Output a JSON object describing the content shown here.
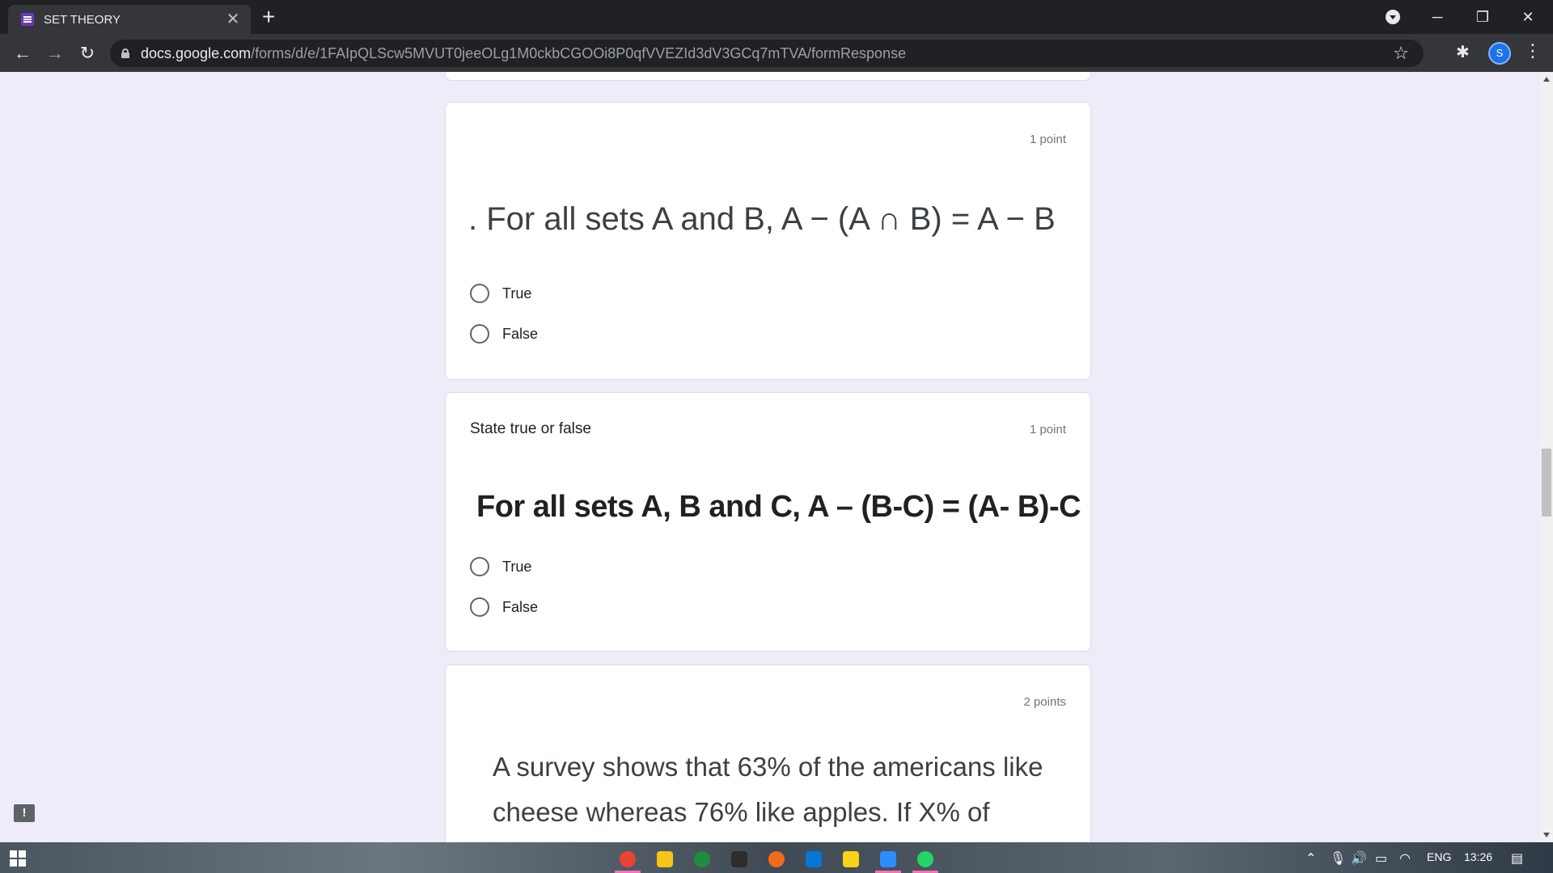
{
  "browser": {
    "tab_title": "SET THEORY",
    "tab_close": "✕",
    "new_tab": "+",
    "url_host": "docs.google.com",
    "url_path": "/forms/d/e/1FAIpQLScw5MVUT0jeeOLg1M0ckbCGOOi8P0qfVVEZId3dV3GCq7mTVA/formResponse",
    "back": "←",
    "forward": "→",
    "reload": "↻",
    "star": "☆",
    "extensions": "✱",
    "menu": "⋮",
    "avatar_initial": "S",
    "minimize": "─",
    "restore": "❐",
    "close": "✕"
  },
  "questions": [
    {
      "points": "1 point",
      "description": "",
      "text": ". For all sets A and B, A − (A ∩ B) = A − B",
      "options": [
        "True",
        "False"
      ]
    },
    {
      "points": "1 point",
      "description": "State true or false",
      "text": "For all sets A, B and C, A – (B-C) = (A- B)-C",
      "options": [
        "True",
        "False"
      ]
    },
    {
      "points": "2 points",
      "description": "",
      "text": "A survey shows that 63% of the americans like cheese whereas 76% like apples. If X% of"
    }
  ],
  "feedback_icon": "!",
  "taskbar": {
    "apps": [
      {
        "name": "chrome",
        "color": "#ea4335",
        "active": true
      },
      {
        "name": "file-explorer",
        "color": "#f5c518",
        "active": false
      },
      {
        "name": "app-green",
        "color": "#1e8e3e",
        "active": false
      },
      {
        "name": "app-terminal",
        "color": "#2d2d2d",
        "active": false
      },
      {
        "name": "app-orange",
        "color": "#f26b1d",
        "active": false
      },
      {
        "name": "vscode",
        "color": "#0078d4",
        "active": false
      },
      {
        "name": "sticky-notes",
        "color": "#f7d417",
        "active": false
      },
      {
        "name": "zoom",
        "color": "#2d8cff",
        "active": true
      },
      {
        "name": "whatsapp",
        "color": "#25d366",
        "active": true
      }
    ],
    "language": "ENG",
    "time": "13:26"
  }
}
